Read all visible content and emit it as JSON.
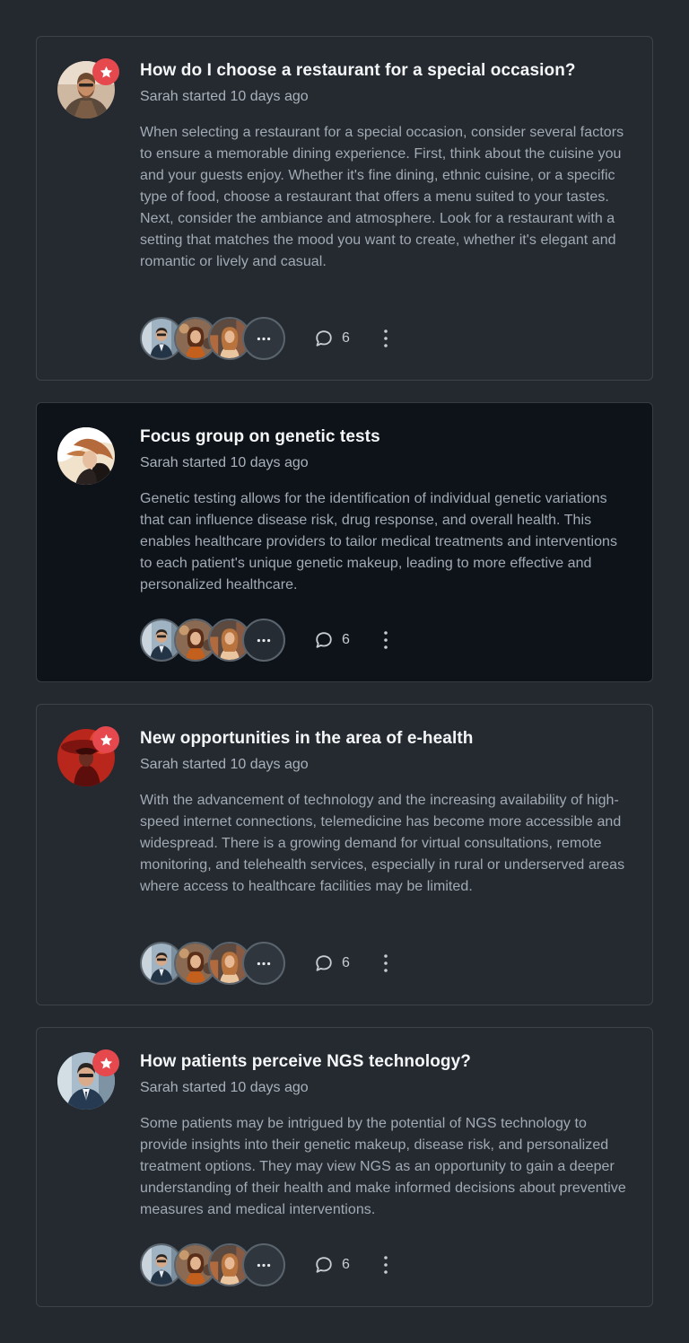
{
  "threads": [
    {
      "title": "How do I choose a restaurant for a special occasion?",
      "meta": "Sarah started 10 days ago",
      "body": "When selecting a restaurant for a special occasion, consider several factors to ensure a memorable dining experience. First, think about the cuisine you and your guests enjoy. Whether it's fine dining, ethnic cuisine, or a specific type of food, choose a restaurant that offers a menu suited to your tastes. Next, consider the ambiance and atmosphere. Look for a restaurant with a setting that matches the mood you want to create, whether it's elegant and romantic or lively and casual.",
      "comment_count": "6",
      "starred": true
    },
    {
      "title": "Focus group on genetic tests",
      "meta": "Sarah started 10 days ago",
      "body": "Genetic testing allows for the identification of individual genetic variations that can influence disease risk, drug response, and overall health. This enables healthcare providers to tailor medical treatments and interventions to each patient's unique genetic makeup, leading to more effective and personalized healthcare.",
      "comment_count": "6",
      "starred": false
    },
    {
      "title": "New opportunities in the area of e-health",
      "meta": "Sarah started 10 days ago",
      "body": "With the advancement of technology and the increasing availability of high-speed internet connections, telemedicine has become more accessible and widespread. There is a growing demand for virtual consultations, remote monitoring, and telehealth services, especially in rural or underserved areas where access to healthcare facilities may be limited.",
      "comment_count": "6",
      "starred": true
    },
    {
      "title": "How patients perceive NGS technology?",
      "meta": "Sarah started 10 days ago",
      "body": "Some patients may be intrigued by the potential of NGS technology to provide insights into their genetic makeup, disease risk, and personalized treatment options. They may view NGS as an opportunity to gain a deeper understanding of their health and make informed decisions about preventive measures and medical interventions.",
      "comment_count": "6",
      "starred": true
    }
  ],
  "colors": {
    "page_bg": "#23292f",
    "card_bg": "#242a30",
    "card_bg_highlighted": "#0e131a",
    "star_badge": "#e5484d",
    "title": "#f4f6f8",
    "body_text": "#a2aab3"
  },
  "icons": {
    "badge": "star-icon",
    "more_participants": "ellipsis-icon",
    "comments": "comment-bubble-icon",
    "options": "kebab-menu-icon"
  }
}
